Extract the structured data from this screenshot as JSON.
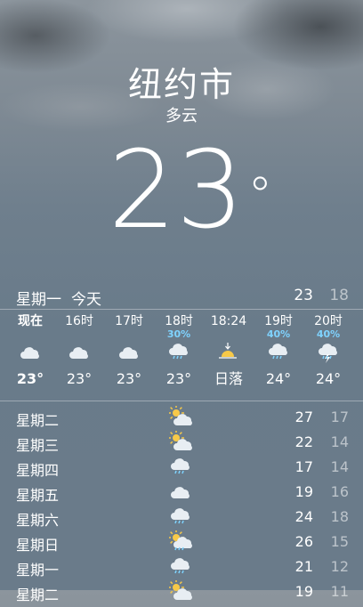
{
  "header": {
    "city": "纽约市",
    "condition": "多云",
    "temperature": "23",
    "degree_symbol": "°"
  },
  "today": {
    "day": "星期一",
    "label": "今天",
    "high": "23",
    "low": "18"
  },
  "hourly": [
    {
      "time": "现在",
      "pop": "",
      "icon": "cloudy-icon",
      "temp": "23°"
    },
    {
      "time": "16时",
      "pop": "",
      "icon": "cloudy-icon",
      "temp": "23°"
    },
    {
      "time": "17时",
      "pop": "",
      "icon": "cloudy-icon",
      "temp": "23°"
    },
    {
      "time": "18时",
      "pop": "30%",
      "icon": "rain-icon",
      "temp": "23°"
    },
    {
      "time": "18:24",
      "pop": "",
      "icon": "sunset-icon",
      "temp": "日落"
    },
    {
      "time": "19时",
      "pop": "40%",
      "icon": "rain-icon",
      "temp": "24°"
    },
    {
      "time": "20时",
      "pop": "40%",
      "icon": "thunderstorm-icon",
      "temp": "24°"
    }
  ],
  "daily": [
    {
      "day": "星期二",
      "icon": "partly-sunny-icon",
      "high": "27",
      "low": "17"
    },
    {
      "day": "星期三",
      "icon": "partly-sunny-icon",
      "high": "22",
      "low": "14"
    },
    {
      "day": "星期四",
      "icon": "rain-icon",
      "high": "17",
      "low": "14"
    },
    {
      "day": "星期五",
      "icon": "cloudy-icon",
      "high": "19",
      "low": "16"
    },
    {
      "day": "星期六",
      "icon": "rain-icon",
      "high": "24",
      "low": "18"
    },
    {
      "day": "星期日",
      "icon": "sun-rain-icon",
      "high": "26",
      "low": "15"
    },
    {
      "day": "星期一",
      "icon": "rain-icon",
      "high": "21",
      "low": "12"
    },
    {
      "day": "星期二",
      "icon": "partly-sunny-icon",
      "high": "19",
      "low": "11"
    }
  ],
  "colors": {
    "precip_text": "#7fd3ff",
    "sun": "#f7c948",
    "low_temp": "#b8c1c9"
  }
}
